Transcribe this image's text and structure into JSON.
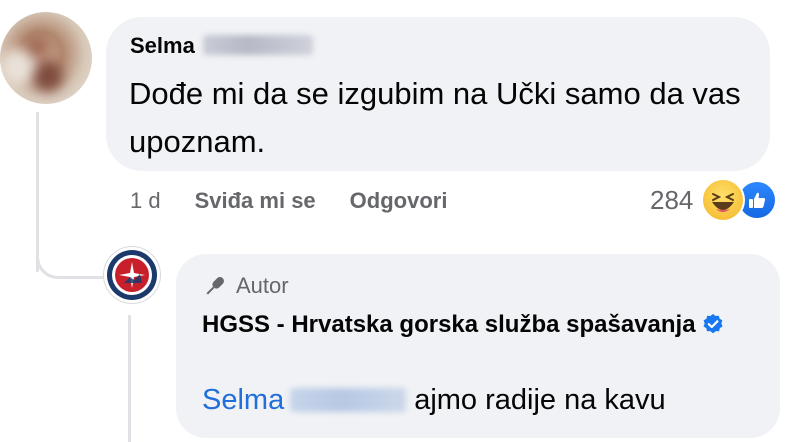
{
  "comment": {
    "author_first_name": "Selma",
    "text": "Dođe mi da se izgubim na Učki samo da vas upoznam.",
    "time": "1 d",
    "like_label": "Sviđa mi se",
    "reply_label": "Odgovori",
    "reaction_count": "284",
    "reaction_icons": [
      "haha-emoji",
      "like-emoji"
    ]
  },
  "reply": {
    "badge_label": "Autor",
    "author_name": "HGSS - Hrvatska gorska služba spašavanja",
    "verified_icon": "verified-badge-icon",
    "mention_first_name": "Selma",
    "text": "ajmo radije na kavu"
  },
  "colors": {
    "bubble": "#f0f2f5",
    "secondary_text": "#65676b",
    "mention": "#216fdb",
    "verified": "#1877f2",
    "hgss_red": "#c8202b"
  }
}
